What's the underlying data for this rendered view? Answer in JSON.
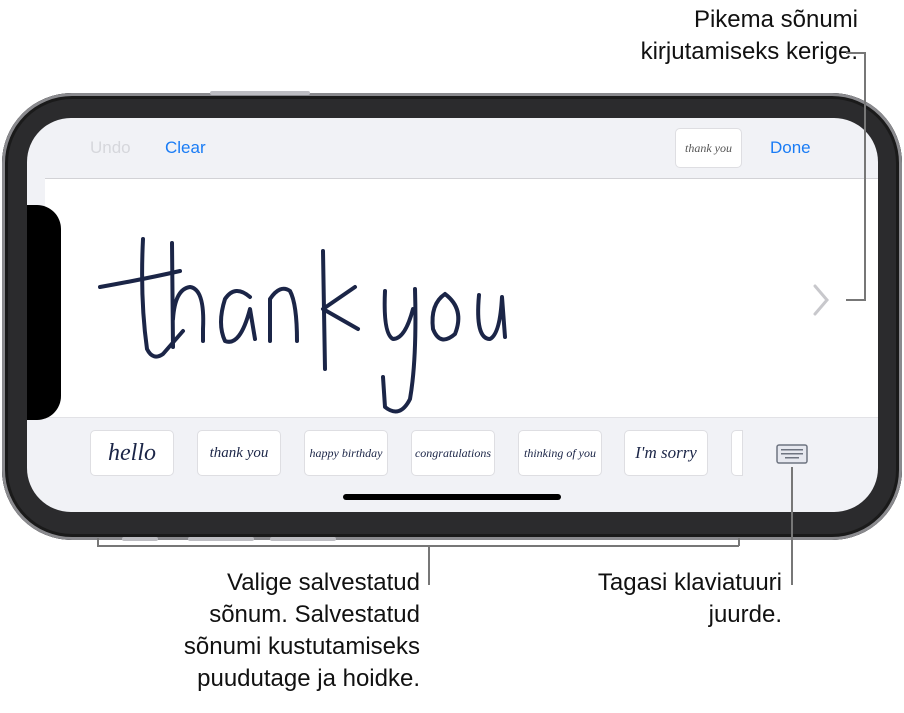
{
  "callouts": {
    "scroll": [
      "Pikema sõnumi",
      "kirjutamiseks kerige."
    ],
    "saved": [
      "Valige salvestatud",
      "sõnum. Salvestatud",
      "sõnumi kustutamiseks",
      "puudutage ja hoidke."
    ],
    "keyboard": [
      "Tagasi klaviatuuri",
      "juurde."
    ]
  },
  "toolbar": {
    "undo": "Undo",
    "clear": "Clear",
    "preview": "thank you",
    "done": "Done"
  },
  "canvas": {
    "handwriting": "thank you",
    "scroll_icon": "chevron-right-icon"
  },
  "saved_messages": [
    "hello",
    "thank you",
    "happy birthday",
    "congratulations",
    "thinking of you",
    "I'm sorry"
  ],
  "keyboard_icon": "keyboard-icon",
  "colors": {
    "accent": "#1a7cf5",
    "ink": "#1b2547",
    "disabled": "#d6d7dc"
  }
}
